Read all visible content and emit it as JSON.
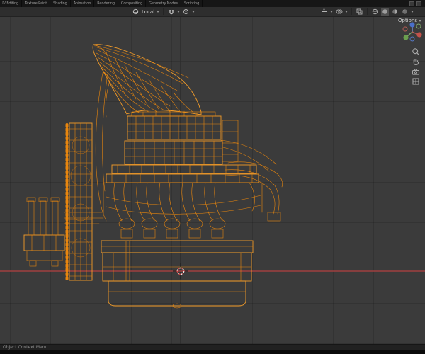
{
  "workspace_tabs": {
    "items": [
      "UV Editing",
      "Texture Paint",
      "Shading",
      "Animation",
      "Rendering",
      "Compositing",
      "Geometry Nodes",
      "Scripting"
    ]
  },
  "header": {
    "orientation": "Local",
    "options": "Options"
  },
  "statusbar": {
    "context_text": "Object Context Menu"
  },
  "colors": {
    "wireframe": "#e8860e",
    "wireframe_bright": "#f49d2a",
    "x_axis_line": "#a04040",
    "viewport_bg": "#3b3b3b",
    "gizmo_x": "#c4524a",
    "gizmo_y": "#6b9e4e",
    "gizmo_z": "#4a6fc9"
  },
  "icons": {
    "orientation": "orientation-globe-icon",
    "snap": "magnet-icon",
    "proportional": "proportional-circle-icon",
    "zoom": "magnifier-icon",
    "pan": "hand-icon",
    "camera": "camera-icon",
    "projection": "ortho-grid-icon"
  }
}
